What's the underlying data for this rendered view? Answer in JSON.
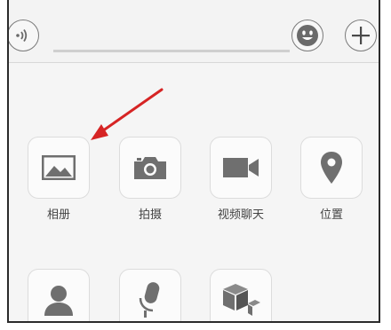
{
  "toolbar": {
    "voice_icon": "voice-icon",
    "emoji_icon": "emoji-icon",
    "plus_icon": "plus-icon",
    "message_input": ""
  },
  "actions": [
    {
      "label": "相册",
      "icon": "image-icon"
    },
    {
      "label": "拍摄",
      "icon": "camera-icon"
    },
    {
      "label": "视频聊天",
      "icon": "video-icon"
    },
    {
      "label": "位置",
      "icon": "location-icon"
    },
    {
      "label": "",
      "icon": "contact-card-icon"
    },
    {
      "label": "",
      "icon": "microphone-icon"
    },
    {
      "label": "",
      "icon": "cube-icon"
    }
  ],
  "annotation": {
    "color": "#d62424"
  },
  "colors": {
    "icon": "#6f6f6f",
    "background": "#f5f5f5"
  }
}
